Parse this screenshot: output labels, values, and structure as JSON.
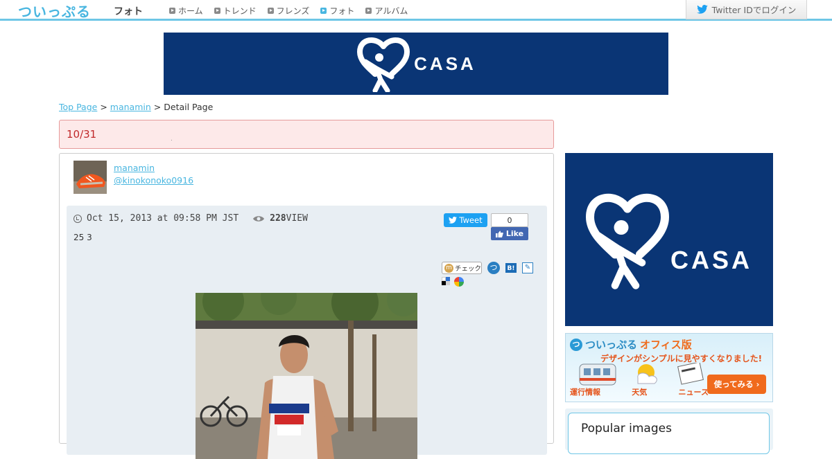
{
  "header": {
    "logo": "ついっぷる",
    "section": "フォト",
    "nav": [
      {
        "label": "ホーム",
        "active": false
      },
      {
        "label": "トレンド",
        "active": false
      },
      {
        "label": "フレンズ",
        "active": false
      },
      {
        "label": "フォト",
        "active": true
      },
      {
        "label": "アルバム",
        "active": false
      }
    ],
    "login_label": "Twitter IDでログイン"
  },
  "ads": {
    "brand": "CASA",
    "brand_color": "#0a3575"
  },
  "breadcrumb": {
    "top": "Top Page",
    "sep1": ">",
    "user": "manamin",
    "sep2": ">",
    "current": "Detail Page"
  },
  "title": {
    "text": "10/31",
    "dot": "."
  },
  "user": {
    "name": "manamin",
    "handle": "@kinokonoko0916"
  },
  "post": {
    "timestamp": "Oct 15, 2013 at 09:58 PM JST",
    "views": "228",
    "views_suffix": "VIEW",
    "counts": "25 3",
    "tweet_label": "Tweet",
    "like_count": "0",
    "like_label": "Like",
    "mixi_label": "チェック",
    "tsu_glyph": "つ",
    "hatena_label": "B!",
    "pencil_glyph": "✎"
  },
  "office_banner": {
    "title_main": "ついっぷる",
    "title_accent": "オフィス版",
    "subtitle": "デザインがシンプルに見やすくなりました!",
    "labels": [
      "運行情報",
      "天気",
      "ニュース"
    ],
    "button": "使ってみる"
  },
  "popular": {
    "title": "Popular images"
  },
  "colors": {
    "accent": "#49b6e0",
    "title_red": "#c0282a",
    "twitter": "#1da1f2",
    "facebook": "#4267b2",
    "orange": "#f06a1c"
  }
}
